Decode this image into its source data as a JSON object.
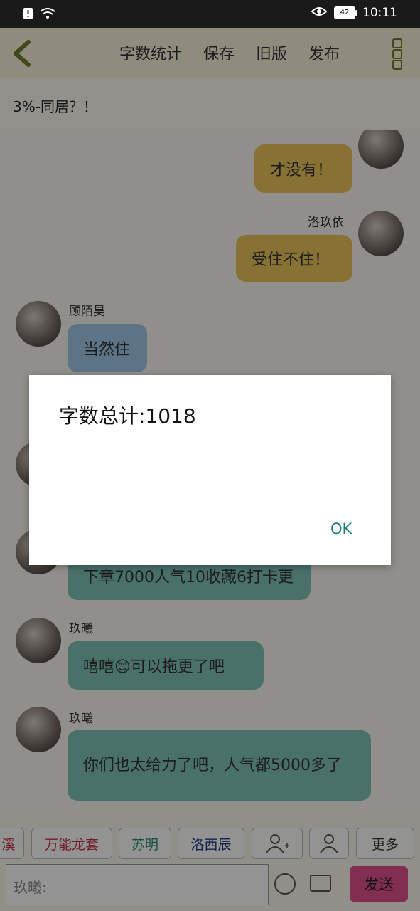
{
  "status_bar": {
    "time": "10:11",
    "battery": "42"
  },
  "app_bar": {
    "menu": [
      "字数统计",
      "保存",
      "旧版",
      "发布"
    ]
  },
  "subtitle": "3%-同居？！",
  "messages": [
    {
      "name": "洛玖依",
      "text": "才没有！"
    },
    {
      "name": "洛玖依",
      "text": "受住不住！"
    },
    {
      "name": "顾陌昊",
      "text": "当然住"
    },
    {
      "name": "",
      "text": "下章7000人气10收藏6打卡更"
    },
    {
      "name": "玖曦",
      "text": "嘻嘻😊可以拖更了吧"
    },
    {
      "name": "玖曦",
      "text": "你们也太给力了吧，人气都5000多了"
    }
  ],
  "dialog": {
    "message": "字数总计:1018",
    "ok": "OK"
  },
  "toolbar": {
    "chips": [
      "溪",
      "万能龙套",
      "苏明",
      "洛西辰",
      "更多"
    ]
  },
  "input": {
    "placeholder": "玖曦:",
    "send": "发送"
  },
  "colors": {
    "yellow_bubble": "#e8c55a",
    "blue_bubble": "#9fc9e6",
    "teal_bubble": "#7fc2b6",
    "send": "#e0508a"
  }
}
